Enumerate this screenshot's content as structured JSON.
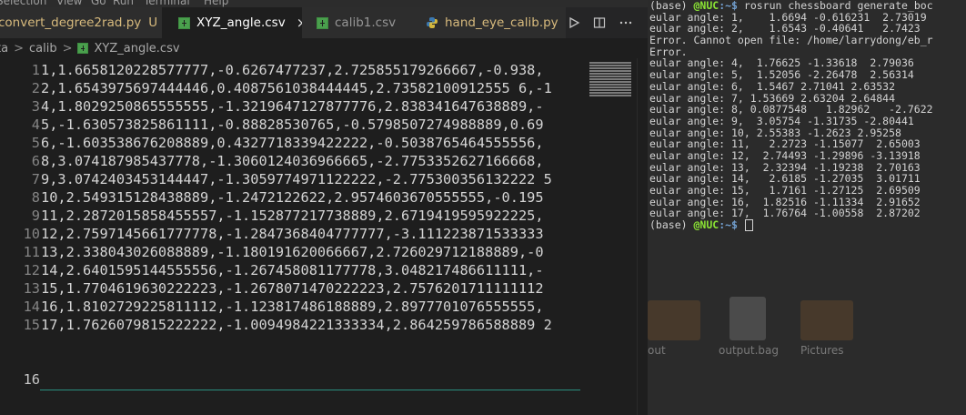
{
  "menubar": {
    "items": [
      "Selection",
      "View",
      "Go",
      "Run",
      "Terminal",
      "Help"
    ]
  },
  "tabs": [
    {
      "label": "convert_degree2rad.py",
      "marker": "U",
      "icon": "python-file-icon",
      "active": false,
      "modified": true
    },
    {
      "label": "XYZ_angle.csv",
      "marker": "×",
      "icon": "csv-file-icon",
      "active": true,
      "modified": false
    },
    {
      "label": "calib1.csv",
      "marker": "",
      "icon": "csv-file-icon",
      "active": false,
      "modified": false
    },
    {
      "label": "hand_eye_calib.py",
      "marker": "M",
      "icon": "python-file-icon",
      "active": false,
      "modified": true
    }
  ],
  "tab_actions": [
    "run-icon",
    "split-editor-icon",
    "more-actions-icon"
  ],
  "breadcrumb": {
    "parts": [
      "ta",
      "calib",
      "XYZ_angle.csv"
    ],
    "separator": ">"
  },
  "editor": {
    "lines": [
      {
        "num": "1",
        "text": "1,1.6658120228577777,-0.6267477237,2.725855179266667,-0.938,"
      },
      {
        "num": "2",
        "text": "2,1.6543975697444446,0.4087561038444445,2.73582100912555 6,-1"
      },
      {
        "num": "3",
        "text": "4,1.8029250865555555,-1.3219647127877776,2.838341647638889,-"
      },
      {
        "num": "4",
        "text": "5,-1.630573825861111,-0.88828530765,-0.5798507274988889,0.69"
      },
      {
        "num": "5",
        "text": "6,-1.603538676208889,0.4327718339422222,-0.5038765464555556,"
      },
      {
        "num": "6",
        "text": "8,3.074187985437778,-1.3060124036966665,-2.7753352627166668,"
      },
      {
        "num": "7",
        "text": "9,3.0742403453144447,-1.3059774971122222,-2.775300356132222 5"
      },
      {
        "num": "8",
        "text": "10,2.549315128438889,-1.2472122622,2.9574603670555555,-0.195"
      },
      {
        "num": "9",
        "text": "11,2.2872015858455557,-1.152877217738889,2.6719419595922225,"
      },
      {
        "num": "10",
        "text": "12,2.7597145661777778,-1.2847368404777777,-3.111223871533333"
      },
      {
        "num": "11",
        "text": "13,2.338043026088889,-1.180191620066667,2.726029712188889,-0"
      },
      {
        "num": "12",
        "text": "14,2.6401595144555556,-1.267458081177778,3.048217486611111,-"
      },
      {
        "num": "13",
        "text": "15,1.7704619630222223,-1.2678071470222223,2.7576201711111112"
      },
      {
        "num": "14",
        "text": "16,1.8102729225811112,-1.123817486188889,2.8977701076555555,"
      },
      {
        "num": "15",
        "text": "17,1.7626079815222222,-1.0094984221333334,2.864259786588889 2"
      },
      {
        "num": "16",
        "text": ""
      }
    ]
  },
  "terminal": {
    "prompt_env": "(base)",
    "prompt_user": "@NUC",
    "prompt_path": ":~$",
    "command": "rosrun chessboard generate_boc",
    "output": [
      "eular angle: 1,    1.6694 -0.616231  2.73019",
      "eular angle: 2,    1.6543 -0.40641   2.7423",
      "Error. Cannot open file: /home/larrydong/eb_r",
      "Error.",
      "eular angle: 4,  1.76625 -1.33618  2.79036",
      "eular angle: 5,  1.52056 -2.26478  2.56314",
      "eular angle: 6,  1.5467 2.71041 2.63532",
      "eular angle: 7, 1.53669 2.63204 2.64844",
      "eular angle: 8, 0.0877548   1.82962   -2.7622",
      "eular angle: 9,  3.05754 -1.31735 -2.80441",
      "eular angle: 10, 2.55383 -1.2623 2.95258",
      "eular angle: 11,   2.2723 -1.15077  2.65003",
      "eular angle: 12,  2.74493 -1.29896 -3.13918",
      "eular angle: 13,  2.32394 -1.19238  2.70163",
      "eular angle: 14,   2.6185 -1.27035  3.01711",
      "eular angle: 15,   1.7161 -1.27125  2.69509",
      "eular angle: 16,  1.82516 -1.11334  2.91652",
      "eular angle: 17,  1.76764 -1.00558  2.87202"
    ],
    "background_labels": [
      "out",
      "output.bag",
      "Pictures"
    ]
  },
  "colors": {
    "editor_bg": "#1e1e1e",
    "terminal_bg": "#2b2b2b",
    "prompt_user": "#8ae234",
    "prompt_path": "#729fcf",
    "modified_tab": "#d7ba7d",
    "csv_icon": "#4aa04d"
  }
}
